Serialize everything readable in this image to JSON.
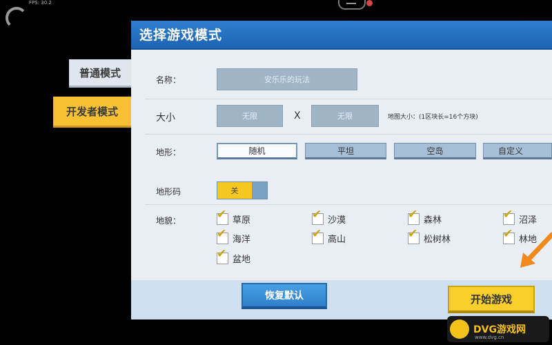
{
  "hud": {
    "fps": "FPS: 30.2"
  },
  "side_tabs": [
    {
      "label": "普通模式",
      "active": false
    },
    {
      "label": "开发者模式",
      "active": true
    }
  ],
  "dialog": {
    "title": "选择游戏模式",
    "name": {
      "label": "名称：",
      "value": "安乐乐的玩法"
    },
    "size": {
      "label": "大小",
      "width": "无限",
      "separator": "X",
      "height": "无限",
      "note": "地图大小：(1区块长=16个方块)"
    },
    "terrain": {
      "label": "地形：",
      "options": [
        "随机",
        "平坦",
        "空岛",
        "自定义"
      ],
      "selected": "随机"
    },
    "terrain_code": {
      "label": "地形码",
      "toggle_state": "关"
    },
    "biomes": {
      "label": "地貌：",
      "items": [
        {
          "name": "草原",
          "checked": true
        },
        {
          "name": "沙漠",
          "checked": true
        },
        {
          "name": "森林",
          "checked": true
        },
        {
          "name": "沼泽",
          "checked": true
        },
        {
          "name": "海洋",
          "checked": true
        },
        {
          "name": "高山",
          "checked": true
        },
        {
          "name": "松树林",
          "checked": true
        },
        {
          "name": "林地",
          "checked": true
        },
        {
          "name": "盆地",
          "checked": true
        }
      ]
    },
    "buttons": {
      "restore": "恢复默认",
      "start": "开始游戏"
    }
  },
  "watermark": {
    "text": "DVG游戏网",
    "sub": "www.dvg.cn"
  },
  "colors": {
    "header": "#1d63b3",
    "accent_yellow": "#f7c133",
    "arrow": "#f08a1c"
  }
}
